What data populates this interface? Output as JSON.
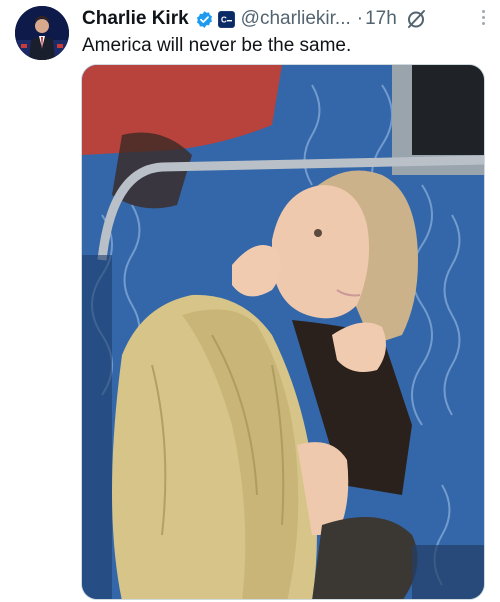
{
  "tweet": {
    "author_name": "Charlie Kirk",
    "handle": "@charliekir...",
    "separator": "·",
    "time": "17h",
    "text": "America will never be the same."
  },
  "icons": {
    "verified": "verified-badge-icon",
    "affiliate": "affiliate-badge-icon",
    "grok": "grok-icon",
    "more": "more-options-icon"
  },
  "colors": {
    "verified_blue": "#1d9bf0",
    "secondary_text": "#536471",
    "primary_text": "#0f1419"
  }
}
